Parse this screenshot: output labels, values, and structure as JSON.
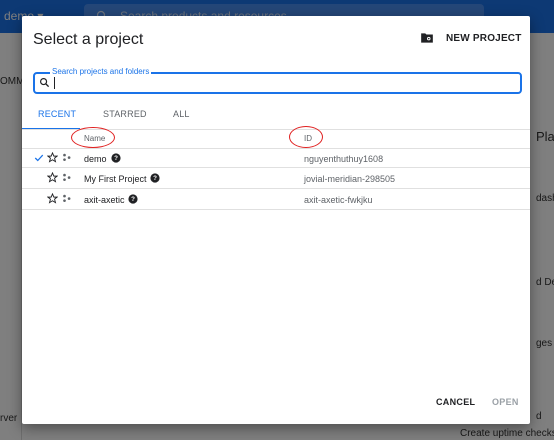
{
  "background": {
    "project_name": "demo",
    "search_placeholder": "Search products and resources",
    "left_tab": "OMM",
    "right_texts": [
      "Pla",
      "dash",
      "d De",
      "ges",
      "d",
      "Create uptime checks"
    ],
    "left_bottom_text": "rver",
    "accent_color": "#1a73e8"
  },
  "dialog": {
    "title": "Select a project",
    "new_project_label": "NEW PROJECT",
    "new_project_icon": "folder-gear-icon",
    "search": {
      "label": "Search projects and folders",
      "value": ""
    },
    "tabs": [
      {
        "label": "RECENT",
        "active": true
      },
      {
        "label": "STARRED",
        "active": false
      },
      {
        "label": "ALL",
        "active": false
      }
    ],
    "columns": {
      "name": "Name",
      "id": "ID"
    },
    "rows": [
      {
        "name": "demo",
        "id": "nguyenthuthuy1608",
        "selected": true
      },
      {
        "name": "My First Project",
        "id": "jovial-meridian-298505",
        "selected": false
      },
      {
        "name": "axit-axetic",
        "id": "axit-axetic-fwkjku",
        "selected": false
      }
    ],
    "footer": {
      "cancel": "CANCEL",
      "open": "OPEN"
    }
  }
}
